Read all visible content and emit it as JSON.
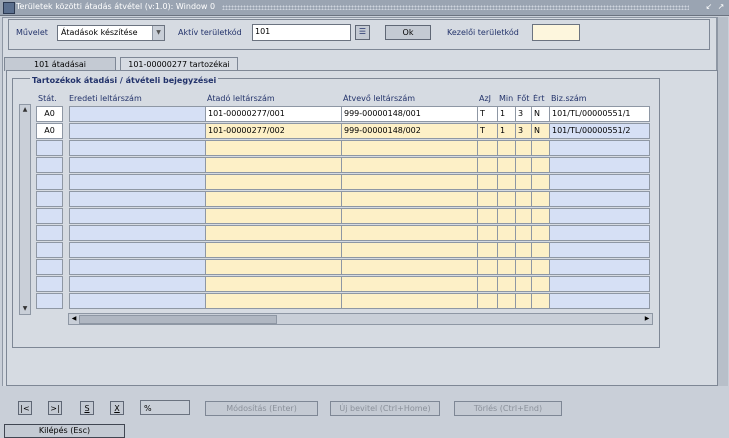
{
  "window": {
    "title": "Területek közötti átadás átvétel (v:1.0): Window 0"
  },
  "header": {
    "muvelet_label": "Művelet",
    "muvelet_value": "Átadások készítése",
    "aktiv_label": "Aktív területkód",
    "aktiv_value": "101",
    "ok_label": "Ok",
    "kezeloi_label": "Kezelői területkód",
    "kezeloi_value": ""
  },
  "tabs": [
    {
      "label": "101 átadásai",
      "active": false
    },
    {
      "label": "101-00000277 tartozékai",
      "active": true
    }
  ],
  "section": {
    "title": "Tartozékok átadási / átvételi bejegyzései"
  },
  "table": {
    "stat_header": "Stát.",
    "headers": [
      "Eredeti leltárszám",
      "Átadó leltárszám",
      "Átvevő leltárszám",
      "AzJ",
      "Min",
      "Főt",
      "Ért",
      "Biz.szám"
    ],
    "rows": [
      {
        "stat": "A0",
        "cells": [
          "",
          "101-00000277/001",
          "999-00000148/001",
          "T",
          "1",
          "3",
          "N",
          "101/TL/00000551/1"
        ]
      },
      {
        "stat": "A0",
        "cells": [
          "",
          "101-00000277/002",
          "999-00000148/002",
          "T",
          "1",
          "3",
          "N",
          "101/TL/00000551/2"
        ]
      }
    ],
    "empty_rows": 10
  },
  "toolbar": {
    "first_label": "|<",
    "last_label": ">|",
    "s_label": "S",
    "x_label": "X",
    "percent": "%",
    "modify_label": "Módosítás (Enter)",
    "new_label": "Új bevitel (Ctrl+Home)",
    "delete_label": "Törlés (Ctrl+End)",
    "exit_label": "Kilépés (Esc)"
  },
  "colors": {
    "blue_cell": "#d6e0f5",
    "yellow_cell": "#fdf0c7",
    "label": "#23336b"
  }
}
